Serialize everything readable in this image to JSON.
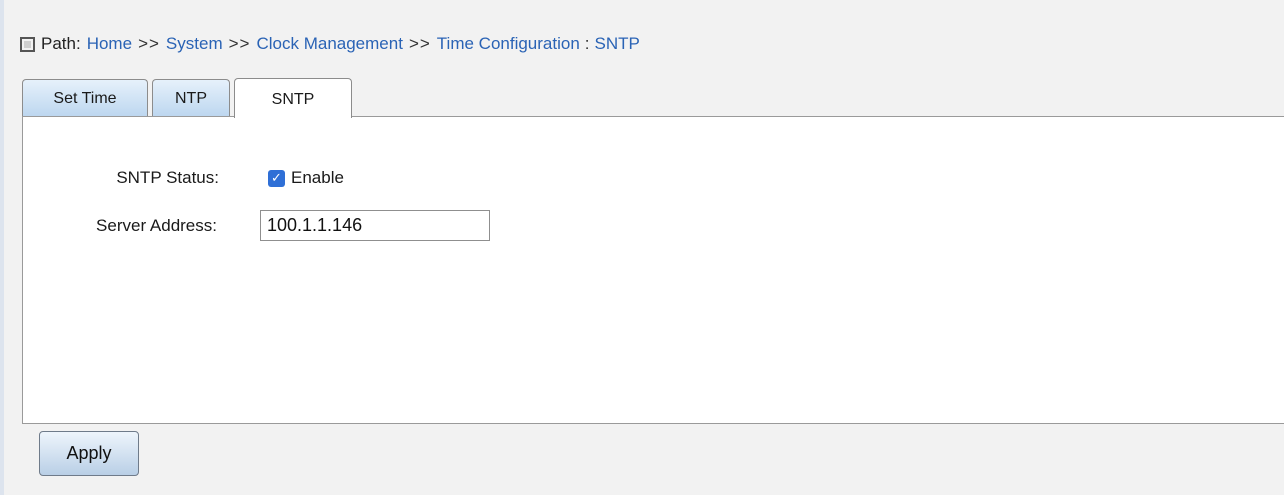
{
  "breadcrumb": {
    "path_label": "Path:",
    "items": [
      "Home",
      "System",
      "Clock Management",
      "Time Configuration"
    ],
    "separator": ">>",
    "current": "SNTP"
  },
  "tabs": [
    {
      "label": "Set Time",
      "active": false
    },
    {
      "label": "NTP",
      "active": false
    },
    {
      "label": "SNTP",
      "active": true
    }
  ],
  "form": {
    "sntp_status_label": "SNTP Status:",
    "sntp_status_checked": true,
    "sntp_status_option": "Enable",
    "server_address_label": "Server Address:",
    "server_address_value": "100.1.1.146"
  },
  "apply_label": "Apply",
  "colors": {
    "link": "#2a63b5",
    "checkbox": "#2f6fd6",
    "tab_gradient_top": "#e6f1fb",
    "tab_gradient_bottom": "#bcd6ef"
  }
}
